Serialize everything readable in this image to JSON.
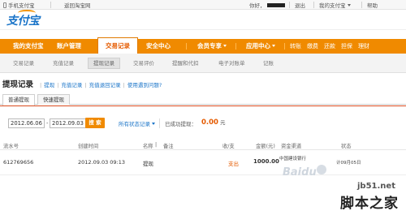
{
  "topbar": {
    "phone_label": "手机支付宝",
    "back_link": "返回淘宝网",
    "greeting": "你好，",
    "logout": "退出",
    "my_alipay": "我的支付宝",
    "help": "帮助"
  },
  "logo": {
    "text": "支付宝"
  },
  "main_nav": {
    "items": [
      "我的支付宝",
      "账户管理",
      "交易记录",
      "安全中心",
      "会员专享",
      "应用中心"
    ],
    "active_index": 2,
    "quick_links": [
      "转账",
      "缴费",
      "还款",
      "担保",
      "理财"
    ]
  },
  "sub_nav": {
    "items": [
      "交易记录",
      "充值记录",
      "提现记录",
      "交易评价",
      "提醒和代扣",
      "电子对账单",
      "记账"
    ],
    "active_index": 2
  },
  "page": {
    "title": "提现记录",
    "links": [
      "提现",
      "充值记录",
      "充值退回记录",
      "使用遇到问题?"
    ]
  },
  "tabs": [
    "普通提现",
    "快速提现"
  ],
  "filter": {
    "date_from": "2012.06.06",
    "date_to": "2012.09.03",
    "search_button": "搜 索",
    "status_filter": "所有状态记录",
    "success_label": "已成功提现：",
    "success_amount": "0.00",
    "success_unit": "元"
  },
  "table": {
    "headers": [
      "流水号",
      "创建时间",
      "名称",
      "备注",
      "收/支",
      "金额(元)",
      "资金渠道",
      "状态"
    ],
    "rows": [
      {
        "serial": "612769656",
        "created": "2012.09.03 09:13",
        "name": "提现",
        "remark": "",
        "direction": "支出",
        "amount": "1000.00",
        "channel": "中国建设银行",
        "status": "计09月05日"
      }
    ]
  },
  "watermark": {
    "url": "jb51.net",
    "site_name": "脚本之家",
    "baidu": "Baidu"
  },
  "colors": {
    "nav_orange": "#f08a00",
    "link_blue": "#1a74c8",
    "amount_orange": "#e55b00",
    "divider_red": "#d94a1e"
  }
}
